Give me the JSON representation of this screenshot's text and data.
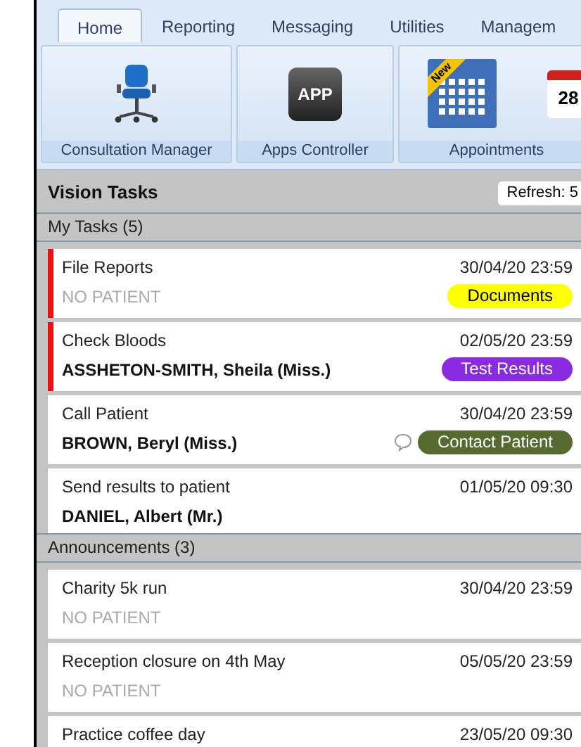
{
  "tabs": [
    {
      "label": "Home",
      "selected": true
    },
    {
      "label": "Reporting",
      "selected": false
    },
    {
      "label": "Messaging",
      "selected": false
    },
    {
      "label": "Utilities",
      "selected": false
    },
    {
      "label": "Managem",
      "selected": false
    }
  ],
  "ribbon": [
    {
      "label": "Consultation Manager",
      "buttons": [
        {
          "kind": "chair"
        }
      ]
    },
    {
      "label": "Apps Controller",
      "buttons": [
        {
          "kind": "app",
          "text": "APP"
        }
      ]
    },
    {
      "label": "Appointments",
      "buttons": [
        {
          "kind": "calendar",
          "badge": "New"
        },
        {
          "kind": "date",
          "text": "28"
        }
      ]
    }
  ],
  "panel": {
    "title": "Vision Tasks",
    "refresh": "Refresh: 5"
  },
  "sections": [
    {
      "title": "My Tasks (5)",
      "items": [
        {
          "title": "File Reports",
          "date": "30/04/20 23:59",
          "patient": "NO PATIENT",
          "no_patient": true,
          "flagged": true,
          "tag": {
            "label": "Documents",
            "color": "#ffff00"
          }
        },
        {
          "title": "Check Bloods",
          "date": "02/05/20 23:59",
          "patient": "ASSHETON-SMITH, Sheila (Miss.)",
          "no_patient": false,
          "flagged": true,
          "tag": {
            "label": "Test Results",
            "color": "#8a2be2"
          }
        },
        {
          "title": "Call Patient",
          "date": "30/04/20 23:59",
          "patient": "BROWN, Beryl (Miss.)",
          "no_patient": false,
          "flagged": false,
          "comment": true,
          "tag": {
            "label": "Contact Patient",
            "color": "#556b2f"
          }
        },
        {
          "title": "Send results to patient",
          "date": "01/05/20 09:30",
          "patient": "DANIEL, Albert (Mr.)",
          "no_patient": false,
          "flagged": false
        }
      ]
    },
    {
      "title": "Announcements (3)",
      "items": [
        {
          "title": "Charity 5k run",
          "date": "30/04/20 23:59",
          "patient": "NO PATIENT",
          "no_patient": true,
          "flagged": false
        },
        {
          "title": "Reception closure on 4th May",
          "date": "05/05/20 23:59",
          "patient": "NO PATIENT",
          "no_patient": true,
          "flagged": false
        },
        {
          "title": "Practice coffee day",
          "date": "23/05/20 09:30",
          "flagged": false
        }
      ]
    }
  ]
}
